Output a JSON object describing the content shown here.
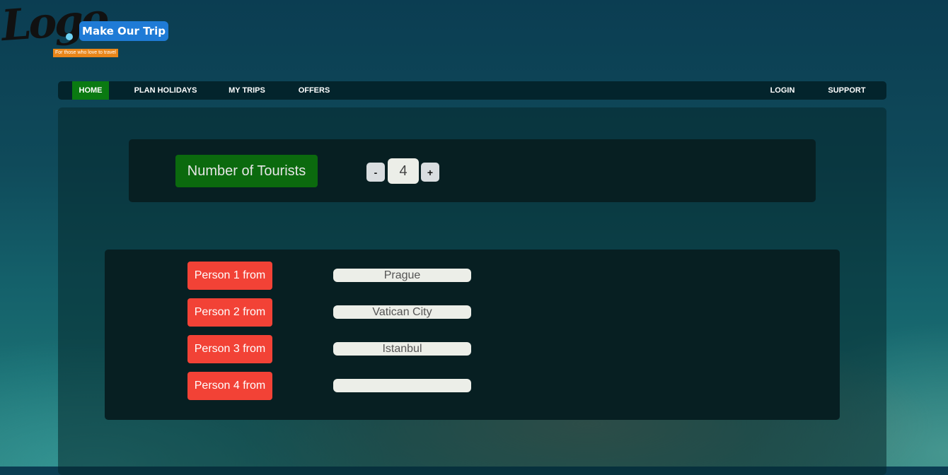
{
  "brand": {
    "logo_text": "Logo",
    "name": "Make Our Trip",
    "tagline": "For those who love to travel"
  },
  "nav": {
    "left": [
      "HOME",
      "PLAN HOLIDAYS",
      "MY TRIPS",
      "OFFERS"
    ],
    "right": [
      "LOGIN",
      "SUPPORT"
    ],
    "active": "HOME"
  },
  "tourists": {
    "label": "Number of Tourists",
    "decrement": "-",
    "increment": "+",
    "count": "4"
  },
  "persons": [
    {
      "label": "Person 1 from",
      "value": "Prague"
    },
    {
      "label": "Person 2 from",
      "value": "Vatican City"
    },
    {
      "label": "Person 3 from",
      "value": "Istanbul"
    },
    {
      "label": "Person 4 from",
      "value": ""
    }
  ],
  "colors": {
    "active_nav": "#0a7a12",
    "brand_pill": "#1f7bd6",
    "tagline_bg": "#e8861a",
    "person_label": "#f24236",
    "tourist_label": "#0b6a0e"
  }
}
